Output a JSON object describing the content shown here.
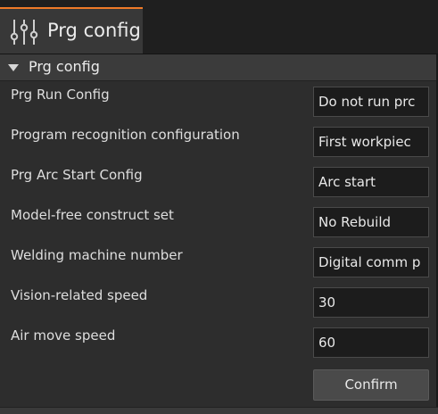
{
  "tab": {
    "label": "Prg config",
    "icon": "sliders-icon",
    "accent_color": "#f07a28"
  },
  "section": {
    "title": "Prg config",
    "icon": "caret-down-icon"
  },
  "fields": [
    {
      "label": "Prg Run Config",
      "value": "Do not run prc"
    },
    {
      "label": "Program recognition configuration",
      "value": "First workpiec"
    },
    {
      "label": "Prg Arc Start Config",
      "value": "Arc start"
    },
    {
      "label": "Model-free construct set",
      "value": "No Rebuild"
    },
    {
      "label": "Welding machine number",
      "value": "Digital comm p"
    },
    {
      "label": "Vision-related speed",
      "value": "30"
    },
    {
      "label": "Air move speed",
      "value": "60"
    }
  ],
  "actions": {
    "confirm_label": "Confirm"
  }
}
